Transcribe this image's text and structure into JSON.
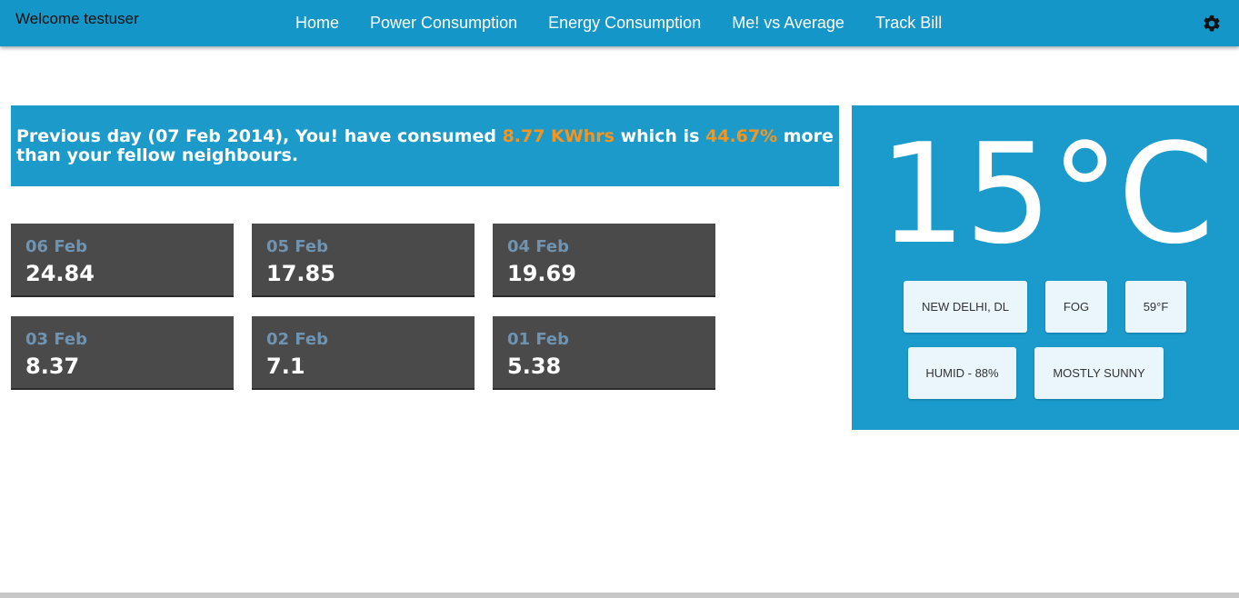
{
  "header": {
    "welcome": "Welcome testuser",
    "nav": [
      "Home",
      "Power Consumption",
      "Energy Consumption",
      "Me! vs Average",
      "Track Bill"
    ],
    "settings_icon": "gear-icon",
    "bg_color": "#1496c8"
  },
  "banner": {
    "text_1": "Previous day (07 Feb 2014), You! have consumed ",
    "consumption": "8.77 KWhrs",
    "text_2": " which is ",
    "percent": "44.67%",
    "text_3": " more than your fellow neighbours.",
    "highlight_color": "#f7941d"
  },
  "days": [
    {
      "date": "06 Feb",
      "value": "24.84"
    },
    {
      "date": "05 Feb",
      "value": "17.85"
    },
    {
      "date": "04 Feb",
      "value": "19.69"
    },
    {
      "date": "03 Feb",
      "value": "8.37"
    },
    {
      "date": "02 Feb",
      "value": "7.1"
    },
    {
      "date": "01 Feb",
      "value": "5.38"
    }
  ],
  "weather": {
    "temperature": "15°C",
    "location": "NEW DELHI, DL",
    "condition": "FOG",
    "fahrenheit": "59°F",
    "humidity": "HUMID - 88%",
    "forecast": "MOSTLY SUNNY"
  }
}
